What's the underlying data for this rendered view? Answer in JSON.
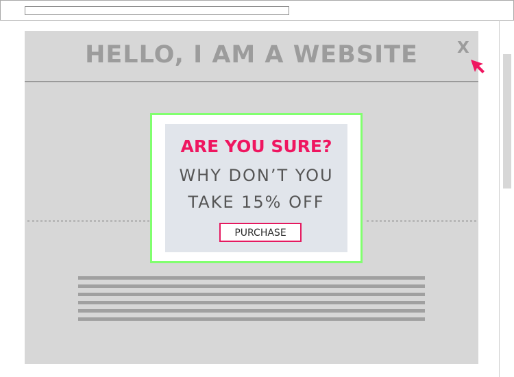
{
  "site": {
    "title": "HELLO, I AM A WEBSITE",
    "close_label": "X"
  },
  "modal": {
    "heading": "ARE YOU SURE?",
    "line_1": "WHY DON’T YOU",
    "line_2": "TAKE 15% OFF",
    "button_label": "PURCHASE"
  },
  "colors": {
    "frame": "#a8a8a8",
    "site_background": "#d7d7d7",
    "site_text": "#9c9c9c",
    "modal_border": "#81ff6f",
    "modal_panel": "#e1e5eb",
    "accent": "#ef1660"
  },
  "icons": {
    "close": "close-icon",
    "cursor": "cursor-arrow-icon"
  }
}
